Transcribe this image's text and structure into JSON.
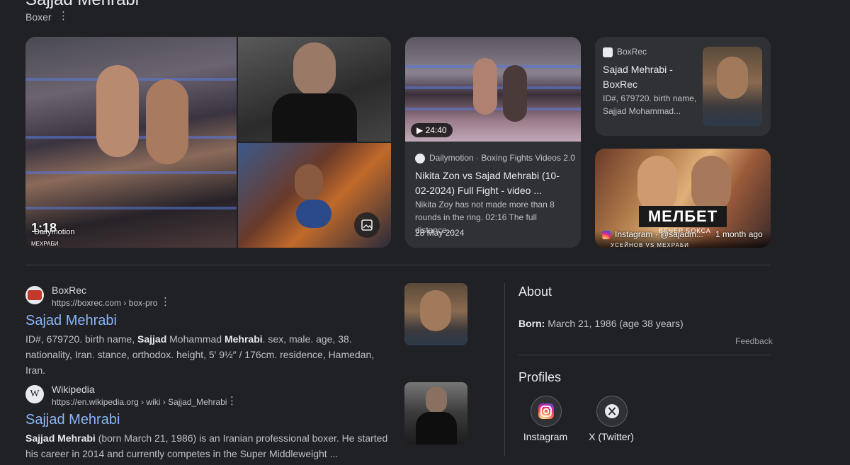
{
  "header": {
    "title": "Sajjad Mehrabi",
    "subtitle": "Boxer"
  },
  "images": {
    "main_source_label": "Dailymotion",
    "main_overlay_time": "1:18",
    "main_overlay_caption": "МЕХРАБИ",
    "poster_brand": "МЕЛБЕТ",
    "poster_sub": "ВЕЧЕР БОКСА",
    "poster_bottom_text": "УСЕЙНОВ  VS  МЕХРАБИ"
  },
  "video_card": {
    "duration": "24:40",
    "source": "Dailymotion · Boxing Fights Videos 2.0",
    "title": "Nikita Zon vs Sajad Mehrabi (10-02-2024) Full Fight - video ...",
    "snippet": "Nikita Zoy has not made more than 8 rounds in the ring. 02:16 The full distance...",
    "date": "28 May 2024"
  },
  "boxrec_card": {
    "source": "BoxRec",
    "title": "Sajad Mehrabi - BoxRec",
    "snippet": "ID#, 679720. birth name, Sajjad Mohammad..."
  },
  "instagram_card": {
    "source": "Instagram · @sajadm...",
    "age": "1 month ago"
  },
  "results": [
    {
      "site": "BoxRec",
      "url": "https://boxrec.com › box-pro",
      "title": "Sajad Mehrabi",
      "snippet_parts": [
        "ID#, 679720. birth name, ",
        "Sajjad",
        " Mohammad ",
        "Mehrabi",
        ". sex, male. age, 38. nationality, Iran. stance, orthodox. height, 5′ 9½″ / 176cm. residence, Hamedan, Iran."
      ]
    },
    {
      "site": "Wikipedia",
      "url": "https://en.wikipedia.org › wiki › Sajjad_Mehrabi",
      "title": "Sajjad Mehrabi",
      "snippet_parts": [
        "Sajjad Mehrabi",
        " (born March 21, 1986) is an Iranian professional boxer. He started his career in 2014 and currently competes in the Super Middleweight ..."
      ]
    }
  ],
  "about": {
    "heading": "About",
    "born_label": "Born:",
    "born_value": " March 21, 1986 (age 38 years)",
    "feedback": "Feedback",
    "profiles_heading": "Profiles",
    "profiles": [
      {
        "label": "Instagram",
        "icon": "instagram-icon"
      },
      {
        "label": "X (Twitter)",
        "icon": "x-icon"
      }
    ]
  }
}
